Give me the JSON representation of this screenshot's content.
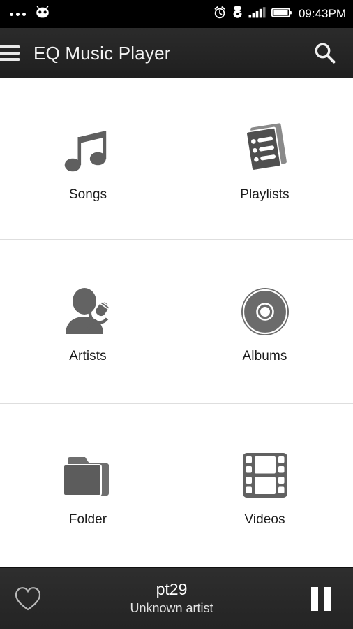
{
  "status_bar": {
    "left_icons": [
      "more-dots-icon",
      "android-robot-icon"
    ],
    "right_icons": [
      "alarm-clock-icon",
      "usb-debug-icon",
      "signal-bars-icon",
      "battery-icon"
    ],
    "clock": "09:43PM",
    "background_color": "#000000"
  },
  "action_bar": {
    "menu_icon": "hamburger-menu-icon",
    "title": "EQ Music Player",
    "search_icon": "search-icon",
    "background_color": "#262626"
  },
  "grid": {
    "divider_color": "#dedede",
    "items": [
      {
        "label": "Songs",
        "icon": "music-note-icon"
      },
      {
        "label": "Playlists",
        "icon": "playlist-documents-icon"
      },
      {
        "label": "Artists",
        "icon": "artist-microphone-icon"
      },
      {
        "label": "Albums",
        "icon": "compact-disc-icon"
      },
      {
        "label": "Folder",
        "icon": "folder-icon"
      },
      {
        "label": "Videos",
        "icon": "film-strip-icon"
      }
    ]
  },
  "now_playing": {
    "favorite_icon": "heart-outline-icon",
    "title": "pt29",
    "artist": "Unknown artist",
    "transport_icon": "pause-icon",
    "background_color": "#2a2a2a"
  },
  "icon_color": "#5a5a5a"
}
